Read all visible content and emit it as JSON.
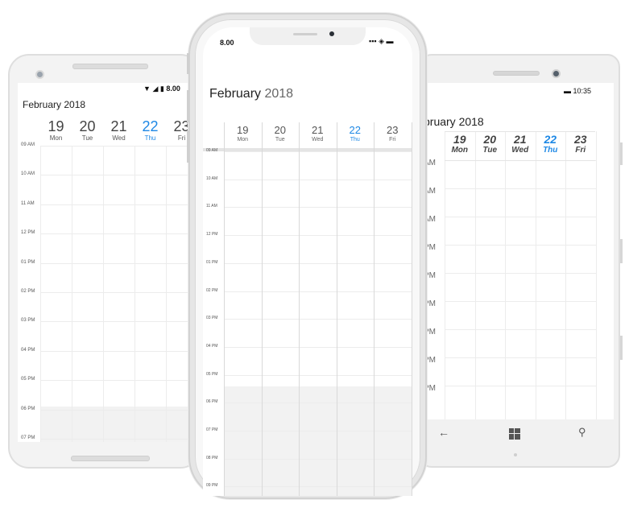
{
  "month": "February",
  "year": "2018",
  "android": {
    "status_time": "8.00",
    "days": [
      {
        "num": "19",
        "name": "Mon",
        "today": false
      },
      {
        "num": "20",
        "name": "Tue",
        "today": false
      },
      {
        "num": "21",
        "name": "Wed",
        "today": false
      },
      {
        "num": "22",
        "name": "Thu",
        "today": true
      },
      {
        "num": "23",
        "name": "Fri",
        "today": false
      }
    ],
    "times": [
      "09 AM",
      "10 AM",
      "11 AM",
      "12 PM",
      "01 PM",
      "02 PM",
      "03 PM",
      "04 PM",
      "05 PM",
      "06 PM",
      "07 PM"
    ]
  },
  "iphone": {
    "status_time": "8.00",
    "days": [
      {
        "num": "19",
        "name": "Mon",
        "today": false
      },
      {
        "num": "20",
        "name": "Tue",
        "today": false
      },
      {
        "num": "21",
        "name": "Wed",
        "today": false
      },
      {
        "num": "22",
        "name": "Thu",
        "today": true
      },
      {
        "num": "23",
        "name": "Fri",
        "today": false
      }
    ],
    "times": [
      "09 AM",
      "10 AM",
      "11 AM",
      "12 PM",
      "01 PM",
      "02 PM",
      "03 PM",
      "04 PM",
      "05 PM",
      "06 PM",
      "07 PM",
      "08 PM",
      "09 PM"
    ]
  },
  "windows": {
    "status_time": "10:35",
    "title_partial": "bruary 2018",
    "days": [
      {
        "num": "19",
        "name": "Mon",
        "today": false
      },
      {
        "num": "20",
        "name": "Tue",
        "today": false
      },
      {
        "num": "21",
        "name": "Wed",
        "today": false
      },
      {
        "num": "22",
        "name": "Thu",
        "today": true
      },
      {
        "num": "23",
        "name": "Fri",
        "today": false
      }
    ],
    "times": [
      "AM",
      "AM",
      "AM",
      "PM",
      "PM",
      "PM",
      "PM",
      "PM",
      "PM"
    ]
  },
  "colors": {
    "today": "#1e88e5",
    "nonwork": "#f2f2f2",
    "grid": "#ececec"
  }
}
